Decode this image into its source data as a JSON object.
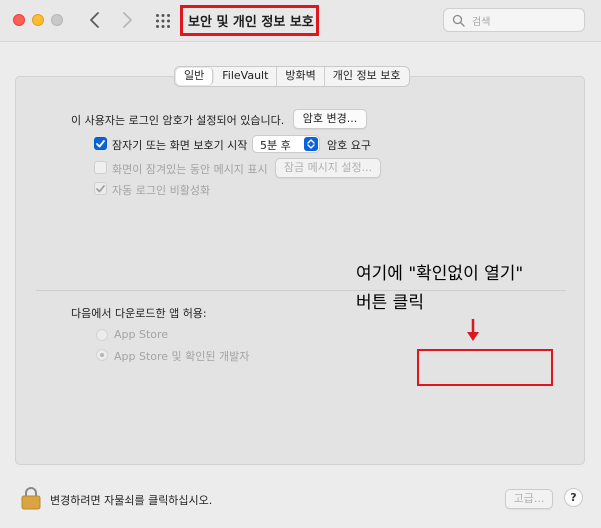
{
  "window": {
    "title": "보안 및 개인 정보 보호",
    "search_placeholder": "검색"
  },
  "tabs": [
    {
      "label": "일반",
      "active": true
    },
    {
      "label": "FileVault",
      "active": false
    },
    {
      "label": "방화벽",
      "active": false
    },
    {
      "label": "개인 정보 보호",
      "active": false
    }
  ],
  "general": {
    "password_notice": "이 사용자는 로그인 암호가 설정되어 있습니다.",
    "change_password_button": "암호 변경...",
    "require_password_label": "잠자기 또는 화면 보호기 시작",
    "require_password_checked": true,
    "require_password_delay": "5분 후",
    "require_password_suffix": "암호 요구",
    "lock_message_label": "화면이 잠겨있는 동안 메시지 표시",
    "lock_message_checked": false,
    "lock_message_button": "잠금 메시지 설정...",
    "disable_auto_login_label": "자동 로그인 비활성화",
    "disable_auto_login_checked": true
  },
  "downloads": {
    "heading": "다음에서 다운로드한 앱 허용:",
    "options": [
      {
        "label": "App Store",
        "selected": false
      },
      {
        "label": "App Store 및 확인된 개발자",
        "selected": true
      }
    ]
  },
  "annotation": {
    "line1": "여기에 \"확인없이 열기\"",
    "line2": "버튼 클릭",
    "color": "#e0161e"
  },
  "footer": {
    "lock_text": "변경하려면 자물쇠를 클릭하십시오.",
    "advanced_button": "고급...",
    "help_button": "?"
  },
  "colors": {
    "accent": "#0a63d8",
    "annotation_red": "#e0161e"
  }
}
